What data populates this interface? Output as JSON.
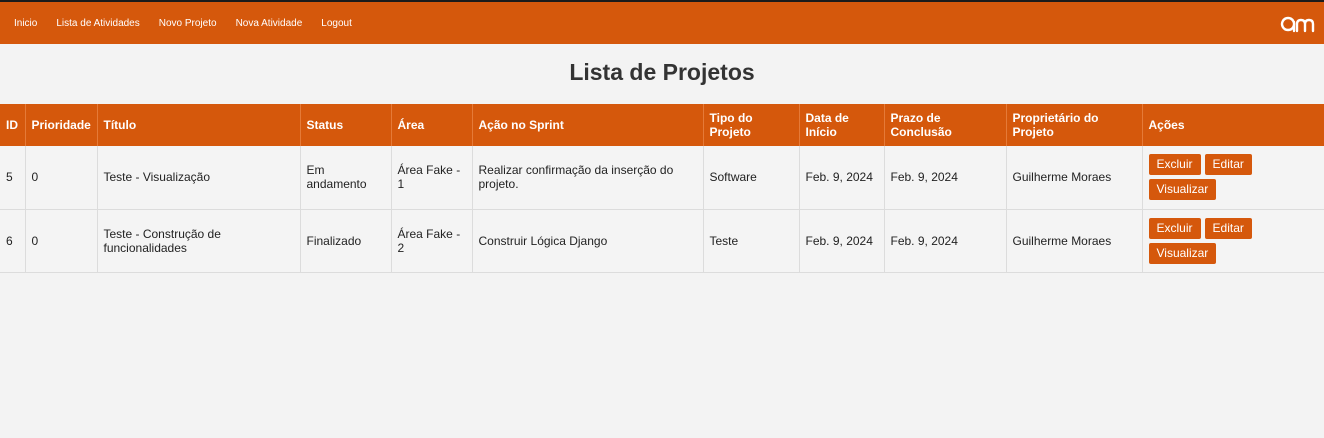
{
  "nav": {
    "items": [
      "Inicio",
      "Lista de Atividades",
      "Novo Projeto",
      "Nova Atividade",
      "Logout"
    ],
    "logo_text": "am"
  },
  "page": {
    "title": "Lista de Projetos"
  },
  "table": {
    "headers": [
      "ID",
      "Prioridade",
      "Título",
      "Status",
      "Área",
      "Ação no Sprint",
      "Tipo do Projeto",
      "Data de Início",
      "Prazo de Conclusão",
      "Proprietário do Projeto",
      "Ações"
    ],
    "rows": [
      {
        "id": "5",
        "prioridade": "0",
        "titulo": "Teste - Visualização",
        "status": "Em andamento",
        "area": "Área Fake - 1",
        "acao": "Realizar confirmação da inserção do projeto.",
        "tipo": "Software",
        "inicio": "Feb. 9, 2024",
        "prazo": "Feb. 9, 2024",
        "proprietario": "Guilherme Moraes"
      },
      {
        "id": "6",
        "prioridade": "0",
        "titulo": "Teste - Construção de funcionalidades",
        "status": "Finalizado",
        "area": "Área Fake - 2",
        "acao": "Construir Lógica Django",
        "tipo": "Teste",
        "inicio": "Feb. 9, 2024",
        "prazo": "Feb. 9, 2024",
        "proprietario": "Guilherme Moraes"
      }
    ],
    "actions": {
      "delete": "Excluir",
      "edit": "Editar",
      "view": "Visualizar"
    }
  },
  "colors": {
    "accent": "#d5580c",
    "background": "#f3f3f3",
    "topbar_border": "#1b1b1b"
  }
}
